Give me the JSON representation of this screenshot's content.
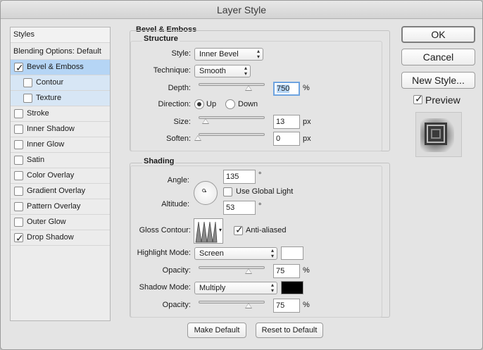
{
  "window": {
    "title": "Layer Style"
  },
  "styles_list": {
    "header": "Styles",
    "blending": "Blending Options: Default",
    "items": [
      {
        "label": "Bevel & Emboss",
        "checked": true,
        "selected": true
      },
      {
        "label": "Contour",
        "checked": false,
        "sub": true
      },
      {
        "label": "Texture",
        "checked": false,
        "sub": true
      },
      {
        "label": "Stroke",
        "checked": false
      },
      {
        "label": "Inner Shadow",
        "checked": false
      },
      {
        "label": "Inner Glow",
        "checked": false
      },
      {
        "label": "Satin",
        "checked": false
      },
      {
        "label": "Color Overlay",
        "checked": false
      },
      {
        "label": "Gradient Overlay",
        "checked": false
      },
      {
        "label": "Pattern Overlay",
        "checked": false
      },
      {
        "label": "Outer Glow",
        "checked": false
      },
      {
        "label": "Drop Shadow",
        "checked": true
      }
    ]
  },
  "bevel": {
    "title": "Bevel & Emboss",
    "structure": {
      "title": "Structure",
      "style_label": "Style:",
      "style_value": "Inner Bevel",
      "technique_label": "Technique:",
      "technique_value": "Smooth",
      "depth_label": "Depth:",
      "depth_value": "750",
      "depth_unit": "%",
      "direction_label": "Direction:",
      "dir_up": "Up",
      "dir_down": "Down",
      "size_label": "Size:",
      "size_value": "13",
      "size_unit": "px",
      "soften_label": "Soften:",
      "soften_value": "0",
      "soften_unit": "px"
    },
    "shading": {
      "title": "Shading",
      "angle_label": "Angle:",
      "angle_value": "135",
      "angle_unit": "°",
      "global_light": "Use Global Light",
      "altitude_label": "Altitude:",
      "altitude_value": "53",
      "altitude_unit": "°",
      "gloss_label": "Gloss Contour:",
      "anti_aliased": "Anti-aliased",
      "highlight_label": "Highlight Mode:",
      "highlight_value": "Screen",
      "highlight_color": "#ffffff",
      "h_opacity_label": "Opacity:",
      "h_opacity_value": "75",
      "h_opacity_unit": "%",
      "shadow_label": "Shadow Mode:",
      "shadow_value": "Multiply",
      "shadow_color": "#000000",
      "s_opacity_label": "Opacity:",
      "s_opacity_value": "75",
      "s_opacity_unit": "%"
    },
    "make_default": "Make Default",
    "reset_default": "Reset to Default"
  },
  "actions": {
    "ok": "OK",
    "cancel": "Cancel",
    "new_style": "New Style...",
    "preview": "Preview"
  }
}
